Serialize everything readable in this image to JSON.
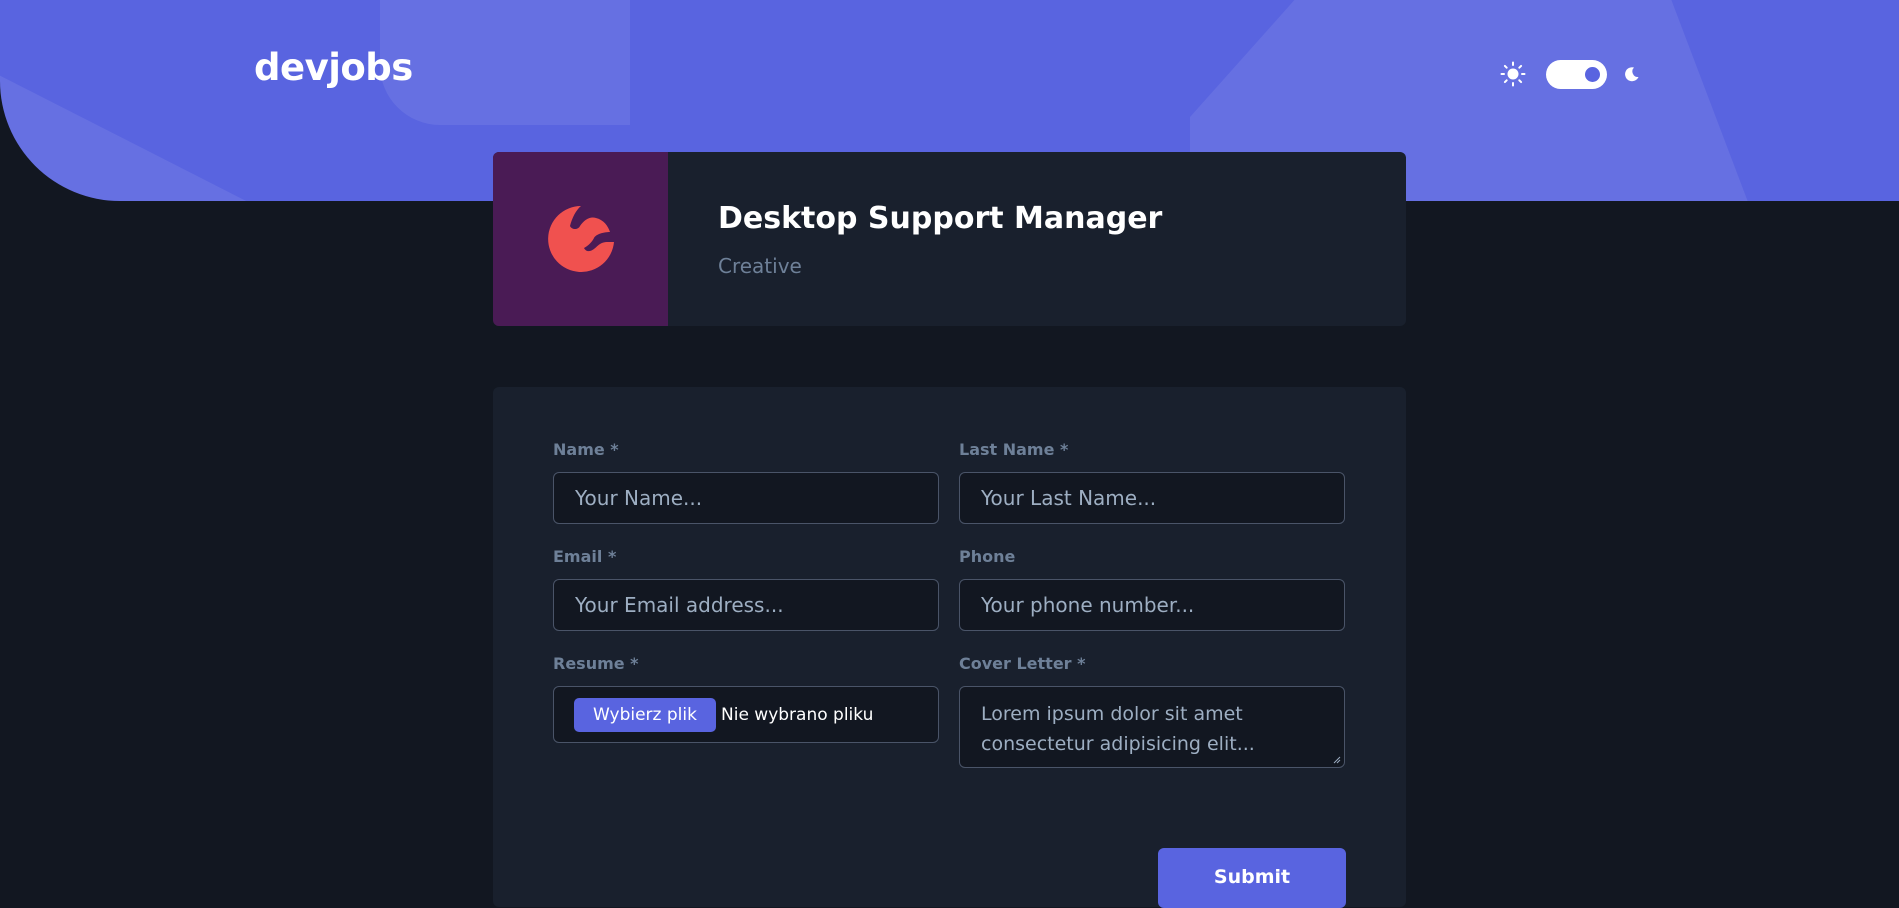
{
  "header": {
    "logo_text": "devjobs",
    "theme": {
      "sun_icon": "sun-icon",
      "moon_icon": "moon-icon",
      "dark_mode_enabled": true
    }
  },
  "company": {
    "job_title": "Desktop Support Manager",
    "company_name": "Creative",
    "logo_icon": "creative-logo-icon",
    "logo_background": "#4A1B55",
    "logo_color": "#F0514F"
  },
  "form": {
    "name": {
      "label": "Name *",
      "placeholder": "Your Name..."
    },
    "last_name": {
      "label": "Last Name *",
      "placeholder": "Your Last Name..."
    },
    "email": {
      "label": "Email *",
      "placeholder": "Your Email address..."
    },
    "phone": {
      "label": "Phone",
      "placeholder": "Your phone number..."
    },
    "resume": {
      "label": "Resume *",
      "button_label": "Wybierz plik",
      "status": "Nie wybrano pliku"
    },
    "cover_letter": {
      "label": "Cover Letter *",
      "placeholder": "Lorem ipsum dolor sit amet consectetur adipisicing elit..."
    },
    "submit_label": "Submit"
  },
  "colors": {
    "accent": "#5964E0",
    "background": "#121721",
    "card": "#19202D",
    "muted_text": "#6E8098"
  }
}
